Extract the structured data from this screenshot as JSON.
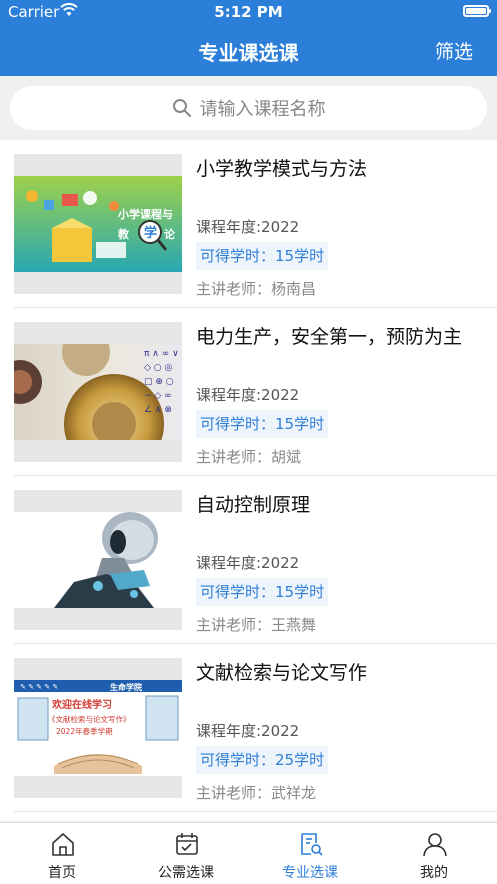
{
  "status": {
    "carrier": "Carrier",
    "time": "5:12 PM"
  },
  "nav": {
    "title": "专业课选课",
    "filter_label": "筛选"
  },
  "search": {
    "placeholder": "请输入课程名称"
  },
  "courses": [
    {
      "title": "小学教学模式与方法",
      "year": "课程年度:2022",
      "hours": "可得学时：15学时",
      "teacher": "主讲老师：杨南昌",
      "thumb_text_1": "小学课程与",
      "thumb_text_2": "教",
      "thumb_text_3": "学",
      "thumb_text_4": "论"
    },
    {
      "title": "电力生产，安全第一，预防为主",
      "year": "课程年度:2022",
      "hours": "可得学时：15学时",
      "teacher": "主讲老师：胡斌"
    },
    {
      "title": "自动控制原理",
      "year": "课程年度:2022",
      "hours": "可得学时：15学时",
      "teacher": "主讲老师：王燕舞"
    },
    {
      "title": "文献检索与论文写作",
      "year": "课程年度:2022",
      "hours": "可得学时：25学时",
      "teacher": "主讲老师：武祥龙",
      "thumb_text_1": "生命学院",
      "thumb_text_2": "欢迎在线学习",
      "thumb_text_3": "《文献检索与论文写作》",
      "thumb_text_4": "2022年春季学期"
    }
  ],
  "tabs": [
    {
      "label": "首页",
      "icon": "home-icon"
    },
    {
      "label": "公需选课",
      "icon": "calendar-icon"
    },
    {
      "label": "专业选课",
      "icon": "doc-search-icon"
    },
    {
      "label": "我的",
      "icon": "user-icon"
    }
  ],
  "colors": {
    "primary": "#2c7fd8",
    "hours_text": "#2f7fd6"
  }
}
